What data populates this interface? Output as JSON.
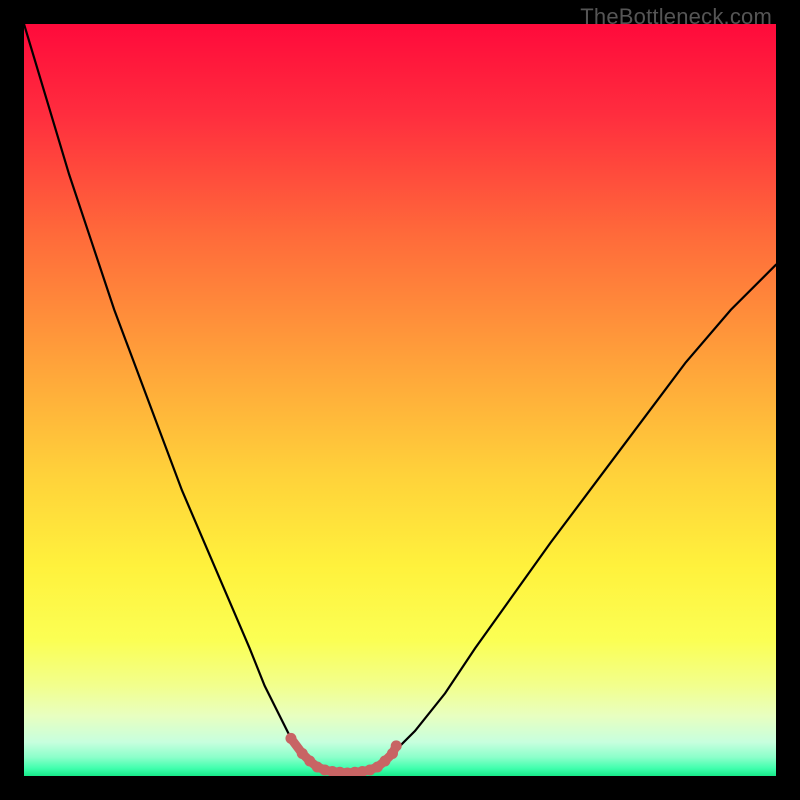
{
  "watermark": "TheBottleneck.com",
  "colors": {
    "frame": "#000000",
    "curve": "#000000",
    "dot": "#c86464",
    "gradient_stops": [
      {
        "offset": 0.0,
        "color": "#ff0a3b"
      },
      {
        "offset": 0.12,
        "color": "#ff2d3e"
      },
      {
        "offset": 0.28,
        "color": "#ff6a3a"
      },
      {
        "offset": 0.45,
        "color": "#ffa23a"
      },
      {
        "offset": 0.6,
        "color": "#ffd23a"
      },
      {
        "offset": 0.72,
        "color": "#fff13c"
      },
      {
        "offset": 0.82,
        "color": "#fbff54"
      },
      {
        "offset": 0.88,
        "color": "#f2ff8d"
      },
      {
        "offset": 0.92,
        "color": "#e8ffc0"
      },
      {
        "offset": 0.955,
        "color": "#c7ffde"
      },
      {
        "offset": 0.975,
        "color": "#8cffca"
      },
      {
        "offset": 0.99,
        "color": "#3fffad"
      },
      {
        "offset": 1.0,
        "color": "#17e889"
      }
    ]
  },
  "chart_data": {
    "type": "line",
    "title": "",
    "xlabel": "",
    "ylabel": "",
    "x_range": [
      0,
      100
    ],
    "y_range": [
      0,
      100
    ],
    "note": "Bottleneck-style V-shaped curve. x = relative component balance (arbitrary 0–100). y = bottleneck percentage (0 = no bottleneck at valley, 100 = severe).",
    "left_branch": {
      "x": [
        0,
        3,
        6,
        9,
        12,
        15,
        18,
        21,
        24,
        27,
        30,
        32,
        34,
        35.5,
        37
      ],
      "y": [
        100,
        90,
        80,
        71,
        62,
        54,
        46,
        38,
        31,
        24,
        17,
        12,
        8,
        5,
        3
      ]
    },
    "valley": {
      "x": [
        37,
        39,
        41,
        43,
        45,
        47,
        49
      ],
      "y": [
        3,
        1.2,
        0.6,
        0.4,
        0.6,
        1.2,
        3
      ]
    },
    "right_branch": {
      "x": [
        49,
        52,
        56,
        60,
        65,
        70,
        76,
        82,
        88,
        94,
        100
      ],
      "y": [
        3,
        6,
        11,
        17,
        24,
        31,
        39,
        47,
        55,
        62,
        68
      ]
    },
    "highlight_dots": {
      "description": "Salmon-colored markers emphasizing the low-bottleneck valley region",
      "x": [
        35.5,
        37,
        38,
        39,
        40,
        41,
        42,
        43,
        44,
        45,
        46,
        47,
        48,
        49,
        49.5
      ],
      "y": [
        5,
        3,
        2,
        1.2,
        0.8,
        0.6,
        0.5,
        0.4,
        0.5,
        0.6,
        0.8,
        1.2,
        2,
        3,
        4
      ]
    }
  }
}
